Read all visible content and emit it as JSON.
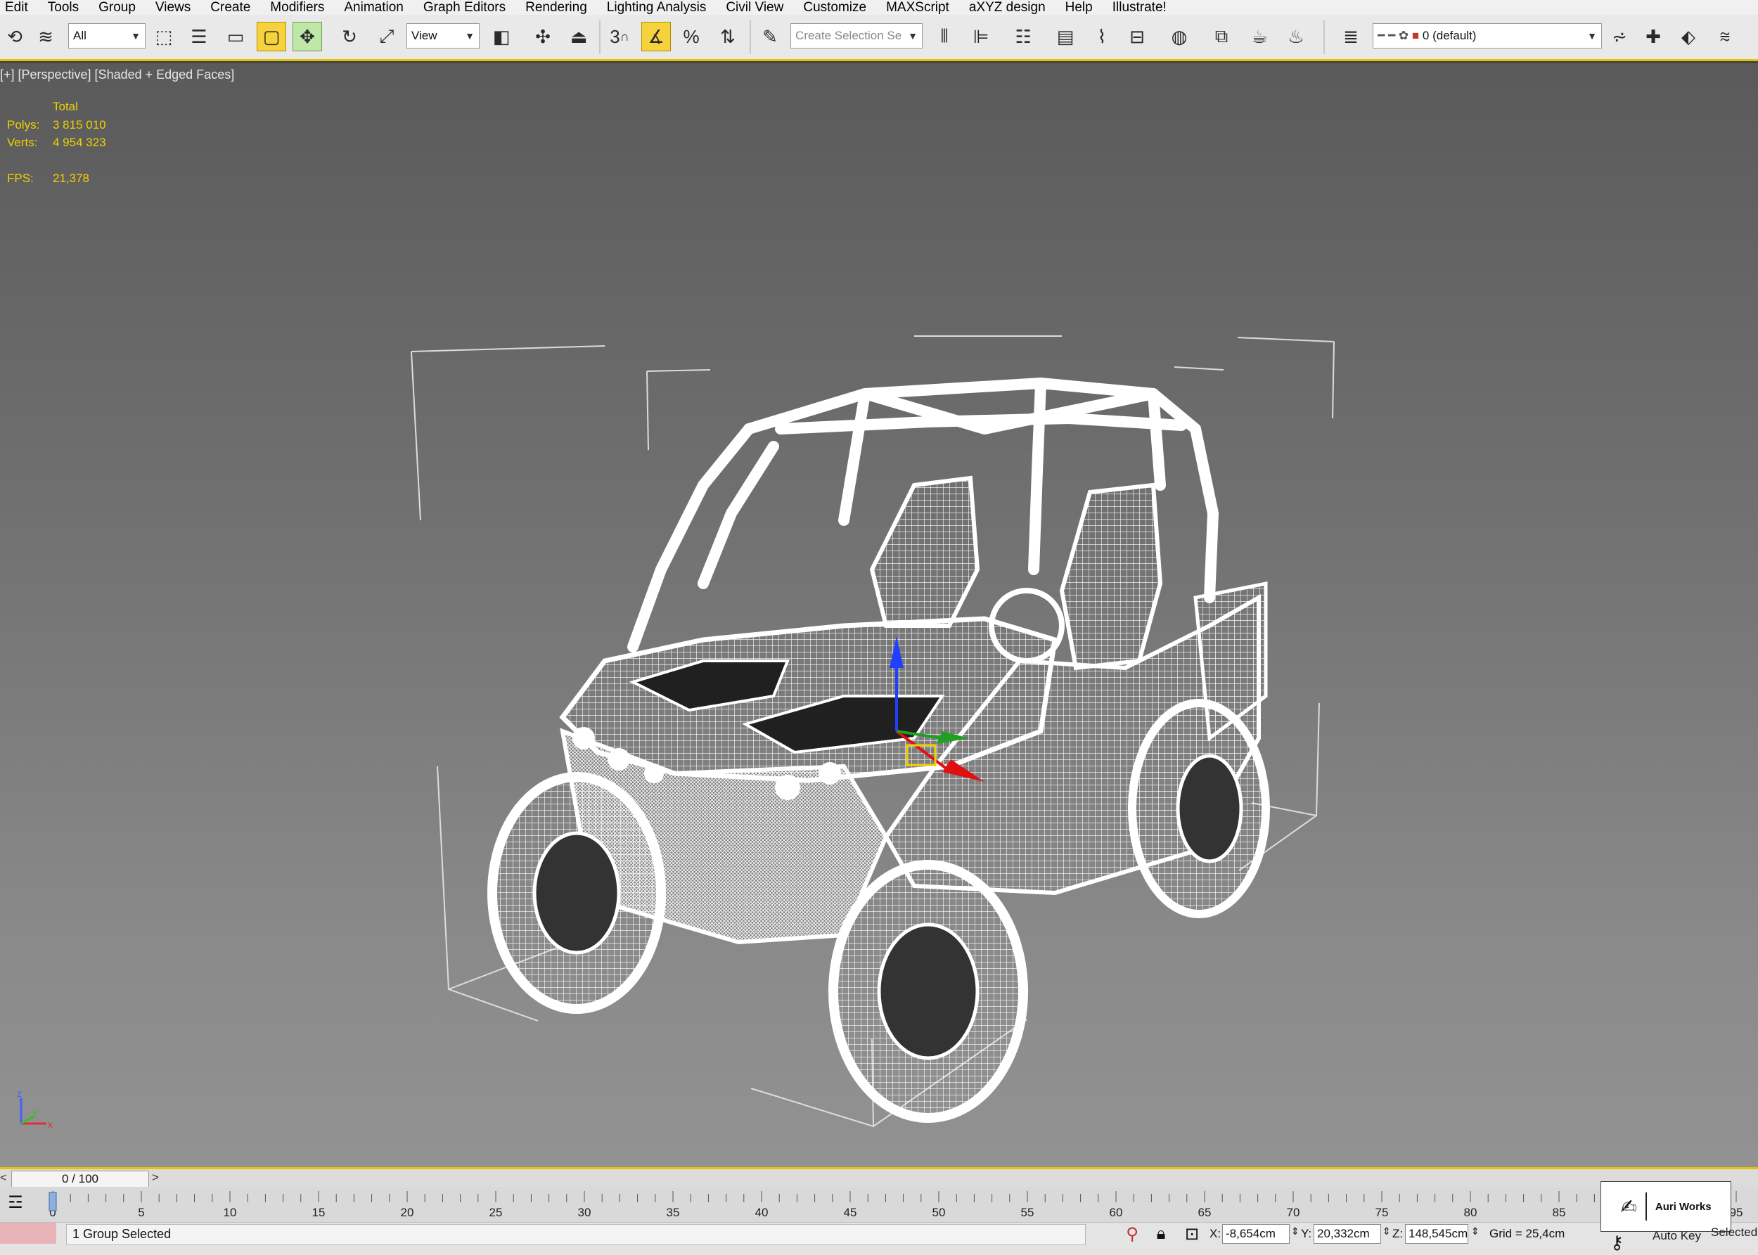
{
  "menu": [
    "Edit",
    "Tools",
    "Group",
    "Views",
    "Create",
    "Modifiers",
    "Animation",
    "Graph Editors",
    "Rendering",
    "Lighting Analysis",
    "Civil View",
    "Customize",
    "MAXScript",
    "aXYZ design",
    "Help",
    "Illustrate!"
  ],
  "toolbar": {
    "selection_filter": "All",
    "reference_coord": "View",
    "named_selection_placeholder": "Create Selection Se",
    "layer_name": "0 (default)",
    "snap_label": "3"
  },
  "viewport": {
    "label": "[+] [Perspective] [Shaded + Edged Faces]",
    "stats": {
      "header": "Total",
      "polys_label": "Polys:",
      "polys": "3 815 010",
      "verts_label": "Verts:",
      "verts": "4 954 323",
      "fps_label": "FPS:",
      "fps": "21,378"
    },
    "axis": {
      "z": "z",
      "x": "x",
      "y": "y"
    }
  },
  "timeline": {
    "frame": "0 / 100",
    "prev": "<",
    "next": ">",
    "ticks": [
      "0",
      "5",
      "10",
      "15",
      "20",
      "25",
      "30",
      "35",
      "40",
      "45",
      "50",
      "55",
      "60",
      "65",
      "70",
      "75",
      "80",
      "85",
      "95"
    ]
  },
  "status": {
    "message": "1 Group Selected",
    "x_label": "X:",
    "x": "-8,654cm",
    "y_label": "Y:",
    "y": "20,332cm",
    "z_label": "Z:",
    "z": "148,545cm",
    "grid": "Grid = 25,4cm",
    "auto_key": "Auto Key",
    "selected": "Selected"
  },
  "watermark": {
    "text": "Auri Works"
  },
  "colors": {
    "accent": "#e6c300",
    "stats": "#f0d000",
    "active_tool": "#f6d23c"
  }
}
